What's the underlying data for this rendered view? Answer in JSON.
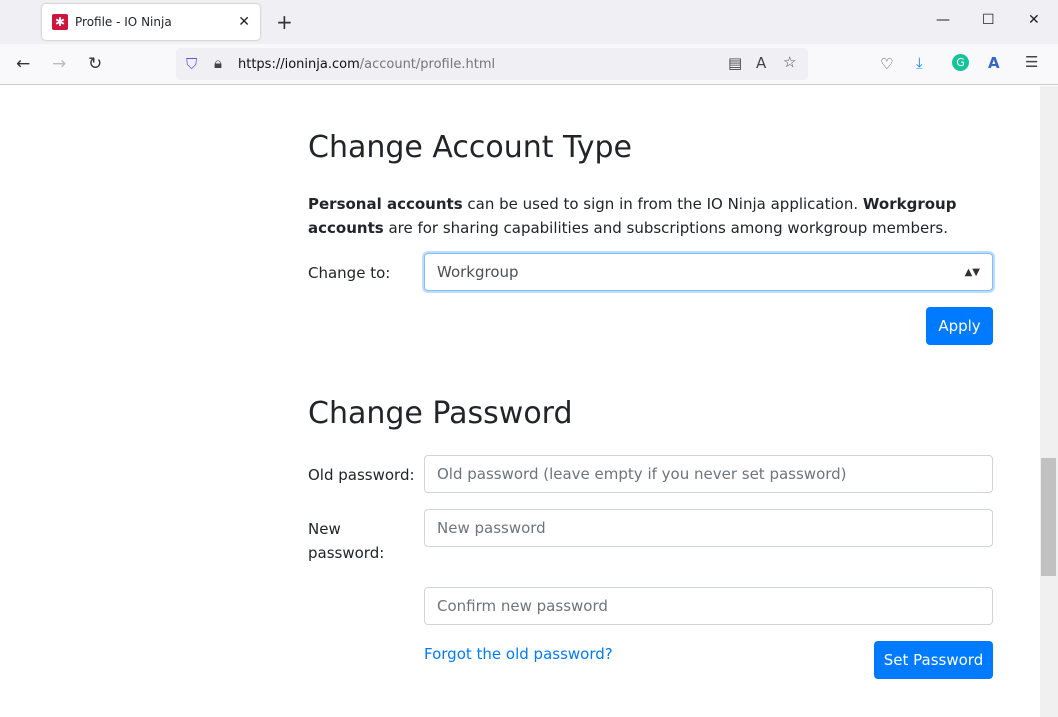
{
  "browser": {
    "tab_title": "Profile - IO Ninja",
    "url_host": "https://ioninja.com",
    "url_path": "/account/profile.html"
  },
  "account_type": {
    "heading": "Change Account Type",
    "desc_bold1": "Personal accounts",
    "desc_1": " can be used to sign in from the IO Ninja application. ",
    "desc_bold2": "Workgroup accounts",
    "desc_2": " are for sharing capabilities and subscriptions among workgroup members.",
    "change_to_label": "Change to:",
    "selected": "Workgroup",
    "apply": "Apply"
  },
  "password": {
    "heading": "Change Password",
    "old_label": "Old password:",
    "old_placeholder": "Old password (leave empty if you never set password)",
    "new_label": "New password:",
    "new_placeholder": "New password",
    "confirm_placeholder": "Confirm new password",
    "forgot": "Forgot the old password?",
    "set": "Set Password"
  },
  "colors": {
    "primary": "#007bff"
  }
}
